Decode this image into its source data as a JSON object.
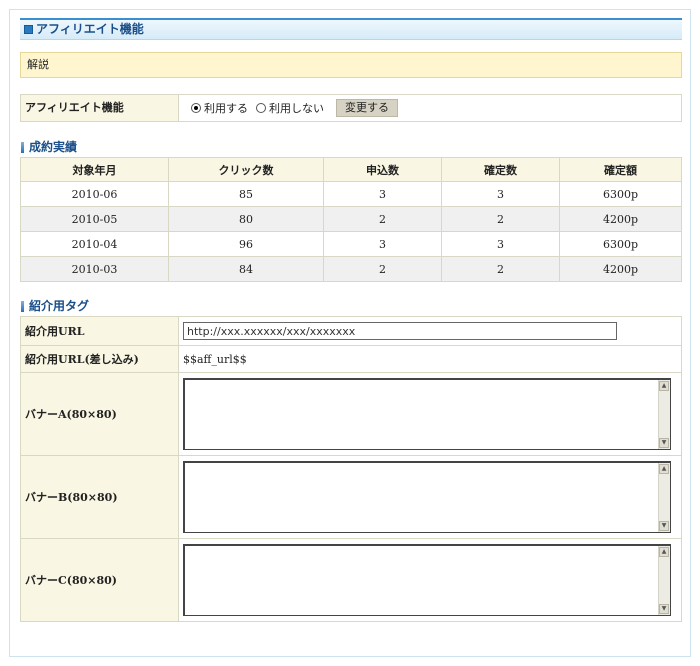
{
  "panel": {
    "title": "アフィリエイト機能"
  },
  "note": {
    "text": "解説"
  },
  "affiliate": {
    "label": "アフィリエイト機能",
    "option_on": "利用する",
    "option_off": "利用しない",
    "selected": "on",
    "button": "変更する"
  },
  "results": {
    "heading": "成約実績",
    "columns": [
      "対象年月",
      "クリック数",
      "申込数",
      "確定数",
      "確定額"
    ],
    "rows": [
      [
        "2010-06",
        "85",
        "3",
        "3",
        "6300p"
      ],
      [
        "2010-05",
        "80",
        "2",
        "2",
        "4200p"
      ],
      [
        "2010-04",
        "96",
        "3",
        "3",
        "6300p"
      ],
      [
        "2010-03",
        "84",
        "2",
        "2",
        "4200p"
      ]
    ]
  },
  "tags": {
    "heading": "紹介用タグ",
    "url_label": "紹介用URL",
    "url_value": "http://xxx.xxxxxx/xxx/xxxxxxx",
    "url_insert_label": "紹介用URL(差し込み)",
    "url_insert_value": "$$aff_url$$",
    "banner_a_label": "バナーA(80×80)",
    "banner_b_label": "バナーB(80×80)",
    "banner_c_label": "バナーC(80×80)"
  },
  "icons": [
    "title-square-icon",
    "section-bar-icon",
    "radio-icon",
    "scroll-up-arrow-icon",
    "scroll-down-arrow-icon"
  ]
}
